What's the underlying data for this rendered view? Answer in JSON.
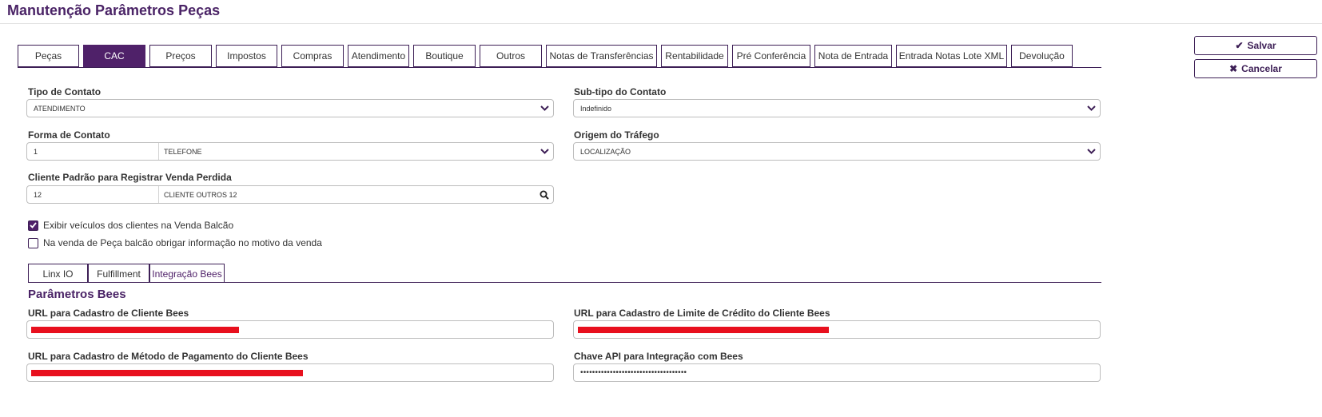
{
  "page": {
    "title": "Manutenção Parâmetros Peças"
  },
  "colors": {
    "brand": "#4f2169",
    "redaction": "#e8101e"
  },
  "tabs": [
    {
      "label": "Peças",
      "active": false
    },
    {
      "label": "CAC",
      "active": true
    },
    {
      "label": "Preços",
      "active": false
    },
    {
      "label": "Impostos",
      "active": false
    },
    {
      "label": "Compras",
      "active": false
    },
    {
      "label": "Atendimento",
      "active": false
    },
    {
      "label": "Boutique",
      "active": false
    },
    {
      "label": "Outros",
      "active": false
    },
    {
      "label": "Notas de Transferências",
      "active": false
    },
    {
      "label": "Rentabilidade",
      "active": false
    },
    {
      "label": "Pré Conferência",
      "active": false
    },
    {
      "label": "Nota de Entrada",
      "active": false
    },
    {
      "label": "Entrada Notas Lote XML",
      "active": false
    },
    {
      "label": "Devolução",
      "active": false
    }
  ],
  "actions": {
    "save": "Salvar",
    "cancel": "Cancelar"
  },
  "form": {
    "tipo_contato": {
      "label": "Tipo de Contato",
      "value": "ATENDIMENTO"
    },
    "subtipo_contato": {
      "label": "Sub-tipo do Contato",
      "value": "Indefinido"
    },
    "forma_contato": {
      "label": "Forma de Contato",
      "code": "1",
      "value": "TELEFONE"
    },
    "origem_trafego": {
      "label": "Origem do Tráfego",
      "value": "LOCALIZAÇÃO"
    },
    "cliente_padrao": {
      "label": "Cliente Padrão para Registrar Venda Perdida",
      "code": "12",
      "value": "CLIENTE OUTROS 12"
    },
    "checkboxes": [
      {
        "label": "Exibir veículos dos clientes na Venda Balcão",
        "checked": true
      },
      {
        "label": "Na venda de Peça balcão obrigar informação no motivo da venda",
        "checked": false
      }
    ]
  },
  "sub_tabs": [
    {
      "label": "Linx IO",
      "active": false
    },
    {
      "label": "Fulfillment",
      "active": false
    },
    {
      "label": "Integração Bees",
      "active": true
    }
  ],
  "bees": {
    "section_title": "Parâmetros Bees",
    "url_cliente_label": "URL para Cadastro de Cliente Bees",
    "url_limite_label": "URL para Cadastro de Limite de Crédito do Cliente Bees",
    "url_pagamento_label": "URL para Cadastro de Método de Pagamento do Cliente Bees",
    "chave_api_label": "Chave API para Integração com Bees",
    "chave_api_value": "••••••••••••••••••••••••••••••••••••"
  },
  "icons": {
    "dropdown": "chevron-down-icon",
    "search": "search-icon",
    "save": "check-icon",
    "cancel": "close-icon",
    "checked": "checkmark-icon"
  }
}
